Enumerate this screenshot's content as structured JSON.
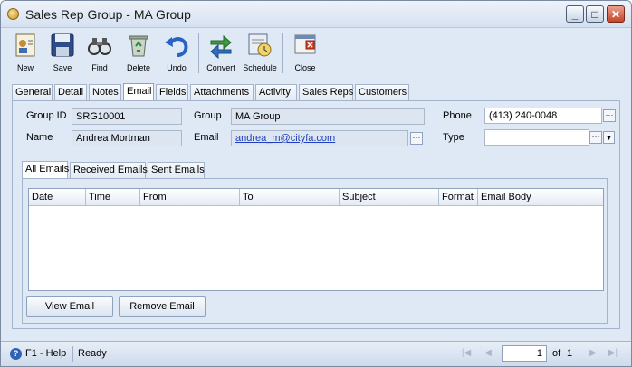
{
  "window": {
    "title": "Sales Rep Group - MA Group"
  },
  "toolbar": [
    {
      "label": "New",
      "icon": "new-record-icon"
    },
    {
      "label": "Save",
      "icon": "floppy-disk-icon"
    },
    {
      "label": "Find",
      "icon": "binoculars-icon"
    },
    {
      "label": "Delete",
      "icon": "recycle-bin-icon"
    },
    {
      "label": "Undo",
      "icon": "undo-arrow-icon"
    },
    {
      "label": "Convert",
      "icon": "convert-arrows-icon"
    },
    {
      "label": "Schedule",
      "icon": "schedule-clock-icon"
    },
    {
      "label": "Close",
      "icon": "close-door-icon"
    }
  ],
  "tabs": [
    "General",
    "Detail",
    "Notes",
    "Email",
    "Fields",
    "Attachments",
    "Activity",
    "Sales Reps",
    "Customers"
  ],
  "active_tab": "Email",
  "form": {
    "group_id_label": "Group ID",
    "group_id_value": "SRG10001",
    "name_label": "Name",
    "name_value": "Andrea Mortman",
    "group_label": "Group",
    "group_value": "MA Group",
    "email_label": "Email",
    "email_value": "andrea_m@cityfa.com",
    "phone_label": "Phone",
    "phone_value": "(413) 240-0048",
    "type_label": "Type",
    "type_value": ""
  },
  "email_tabs": [
    "All Emails",
    "Received Emails",
    "Sent Emails"
  ],
  "grid_columns": [
    "Date",
    "Time",
    "From",
    "To",
    "Subject",
    "Format",
    "Email Body"
  ],
  "buttons": {
    "view": "View Email",
    "remove": "Remove Email"
  },
  "status": {
    "help": "F1 - Help",
    "state": "Ready",
    "page": "1",
    "of_label": "of",
    "total_pages": "1"
  },
  "colors": {
    "accent": "#2f63b5",
    "link": "#1f3fbf",
    "panel": "#dfe9f5"
  }
}
